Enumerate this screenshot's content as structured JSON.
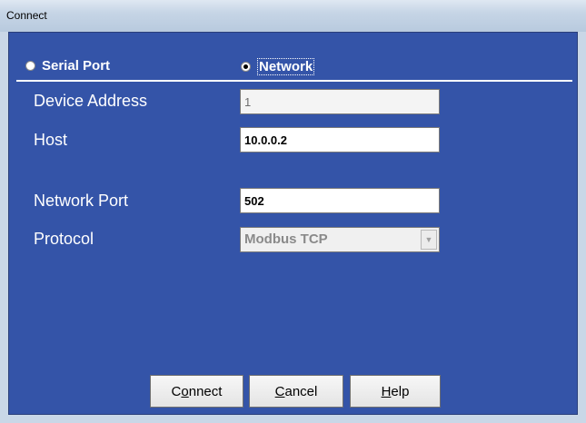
{
  "window": {
    "title": "Connect"
  },
  "connection_type": {
    "serial_label": "Serial Port",
    "network_label": "Network",
    "selected": "Network"
  },
  "fields": {
    "device_address": {
      "label": "Device Address",
      "value": "1"
    },
    "host": {
      "label": "Host",
      "value": "10.0.0.2"
    },
    "network_port": {
      "label": "Network Port",
      "value": "502"
    },
    "protocol": {
      "label": "Protocol",
      "value": "Modbus TCP"
    }
  },
  "buttons": {
    "connect": {
      "pre": "C",
      "accel": "o",
      "post": "nnect"
    },
    "cancel": {
      "pre": "",
      "accel": "C",
      "post": "ancel"
    },
    "help": {
      "pre": "",
      "accel": "H",
      "post": "elp"
    }
  },
  "colors": {
    "panel_background": "#3454a8",
    "titlebar": "#c6d5e6"
  }
}
